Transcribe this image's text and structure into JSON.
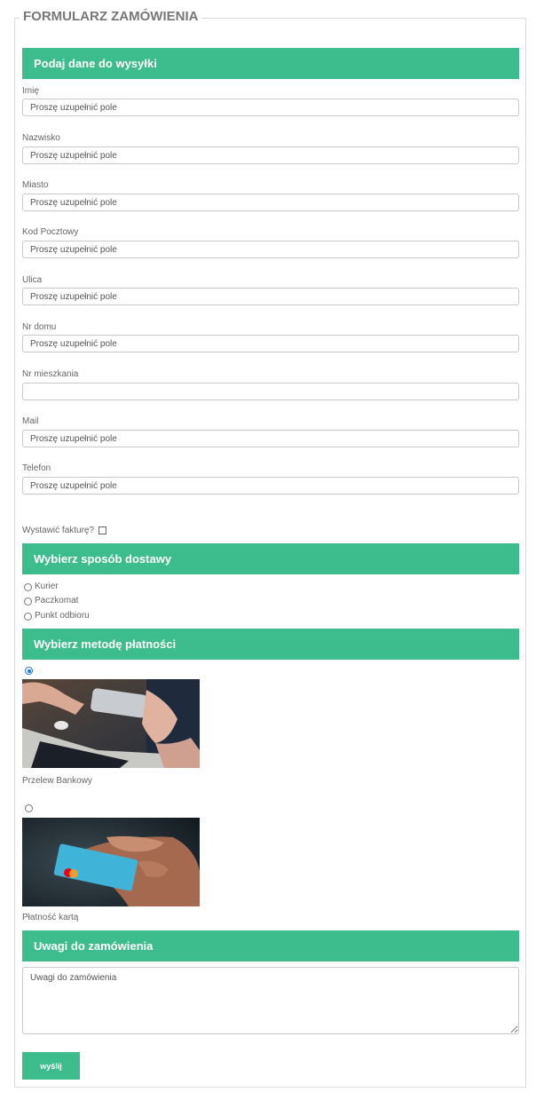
{
  "form": {
    "legend": "FORMULARZ ZAMÓWIENIA",
    "shipping_header": "Podaj dane do wysyłki",
    "fields": [
      {
        "label": "Imię",
        "placeholder": "Proszę uzupełnić pole"
      },
      {
        "label": "Nazwisko",
        "placeholder": "Proszę uzupełnić pole"
      },
      {
        "label": "Miasto",
        "placeholder": "Proszę uzupełnić pole"
      },
      {
        "label": "Kod Pocztowy",
        "placeholder": "Proszę uzupełnić pole"
      },
      {
        "label": "Ulica",
        "placeholder": "Proszę uzupełnić pole"
      },
      {
        "label": "Nr domu",
        "placeholder": "Proszę uzupełnić pole"
      },
      {
        "label": "Nr mieszkania",
        "placeholder": ""
      },
      {
        "label": "Mail",
        "placeholder": "Proszę uzupełnić pole"
      },
      {
        "label": "Telefon",
        "placeholder": "Proszę uzupełnić pole"
      }
    ],
    "invoice_label": "Wystawić fakturę?",
    "invoice_checked": false,
    "delivery_header": "Wybierz sposób dostawy",
    "delivery_options": [
      {
        "label": "Kurier",
        "checked": false
      },
      {
        "label": "Paczkomat",
        "checked": false
      },
      {
        "label": "Punkt odbioru",
        "checked": false
      }
    ],
    "payment_header": "Wybierz metodę płatności",
    "payment_options": [
      {
        "label": "Przelew Bankowy",
        "checked": true,
        "image": "phone-laptop-photo"
      },
      {
        "label": "Płatność kartą",
        "checked": false,
        "image": "credit-card-photo"
      }
    ],
    "notes_header": "Uwagi do zamówienia",
    "notes_placeholder": "Uwagi do zamówienia",
    "submit_label": "wyślij"
  },
  "colors": {
    "accent": "#3dbd8d",
    "selected_radio": "#1a73e8"
  }
}
